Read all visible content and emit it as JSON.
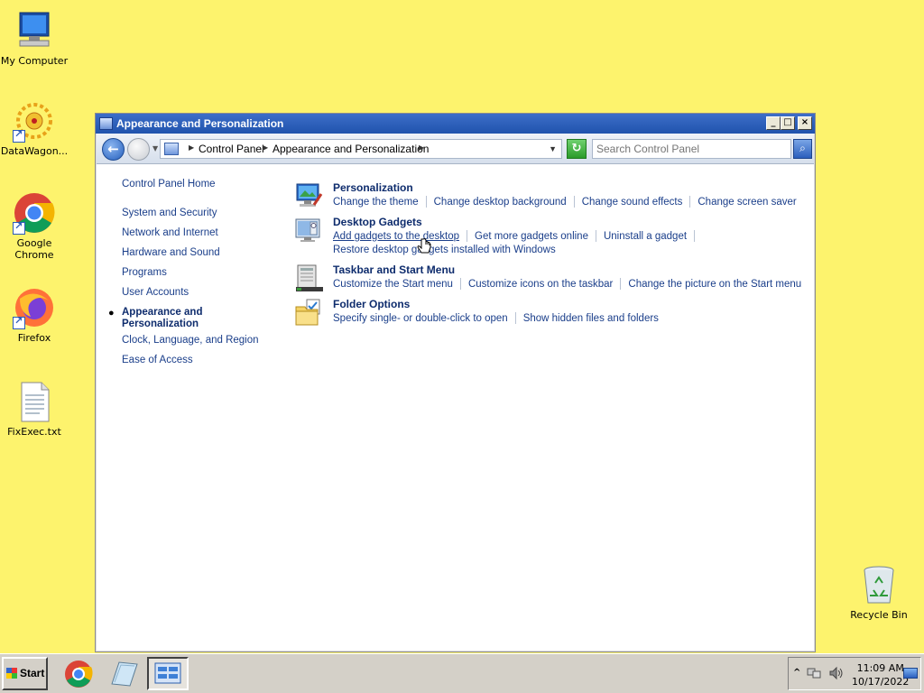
{
  "desktop": {
    "icons": [
      {
        "label": "My Computer"
      },
      {
        "label": "DataWagon..."
      },
      {
        "label": "Google Chrome"
      },
      {
        "label": "Firefox"
      },
      {
        "label": "FixExec.txt"
      },
      {
        "label": "Recycle Bin"
      }
    ]
  },
  "window": {
    "title": "Appearance and Personalization",
    "controls": {
      "minimize": "_",
      "maximize": "□",
      "close": "×"
    },
    "breadcrumb": [
      "Control Panel",
      "Appearance and Personalization"
    ],
    "search": {
      "placeholder": "Search Control Panel"
    }
  },
  "leftnav": {
    "home": "Control Panel Home",
    "items": [
      "System and Security",
      "Network and Internet",
      "Hardware and Sound",
      "Programs",
      "User Accounts",
      "Appearance and Personalization",
      "Clock, Language, and Region",
      "Ease of Access"
    ],
    "current_index": 5
  },
  "sections": [
    {
      "title": "Personalization",
      "icon": "personalization-icon",
      "links": [
        "Change the theme",
        "Change desktop background",
        "Change sound effects",
        "Change screen saver"
      ]
    },
    {
      "title": "Desktop Gadgets",
      "icon": "gadgets-icon",
      "links": [
        "Add gadgets to the desktop",
        "Get more gadgets online",
        "Uninstall a gadget",
        "Restore desktop gadgets installed with Windows"
      ]
    },
    {
      "title": "Taskbar and Start Menu",
      "icon": "taskbar-icon",
      "links": [
        "Customize the Start menu",
        "Customize icons on the taskbar",
        "Change the picture on the Start menu"
      ]
    },
    {
      "title": "Folder Options",
      "icon": "folder-options-icon",
      "links": [
        "Specify single- or double-click to open",
        "Show hidden files and folders"
      ]
    }
  ],
  "taskbar": {
    "start_label": "Start",
    "clock_time": "11:09 AM",
    "clock_date": "10/17/2022",
    "tray_expand": "^"
  },
  "colors": {
    "desktop_bg": "#fdf36d",
    "title_bar": "#2053ad",
    "link": "#1a3e8a",
    "heading": "#0e2c6d"
  }
}
